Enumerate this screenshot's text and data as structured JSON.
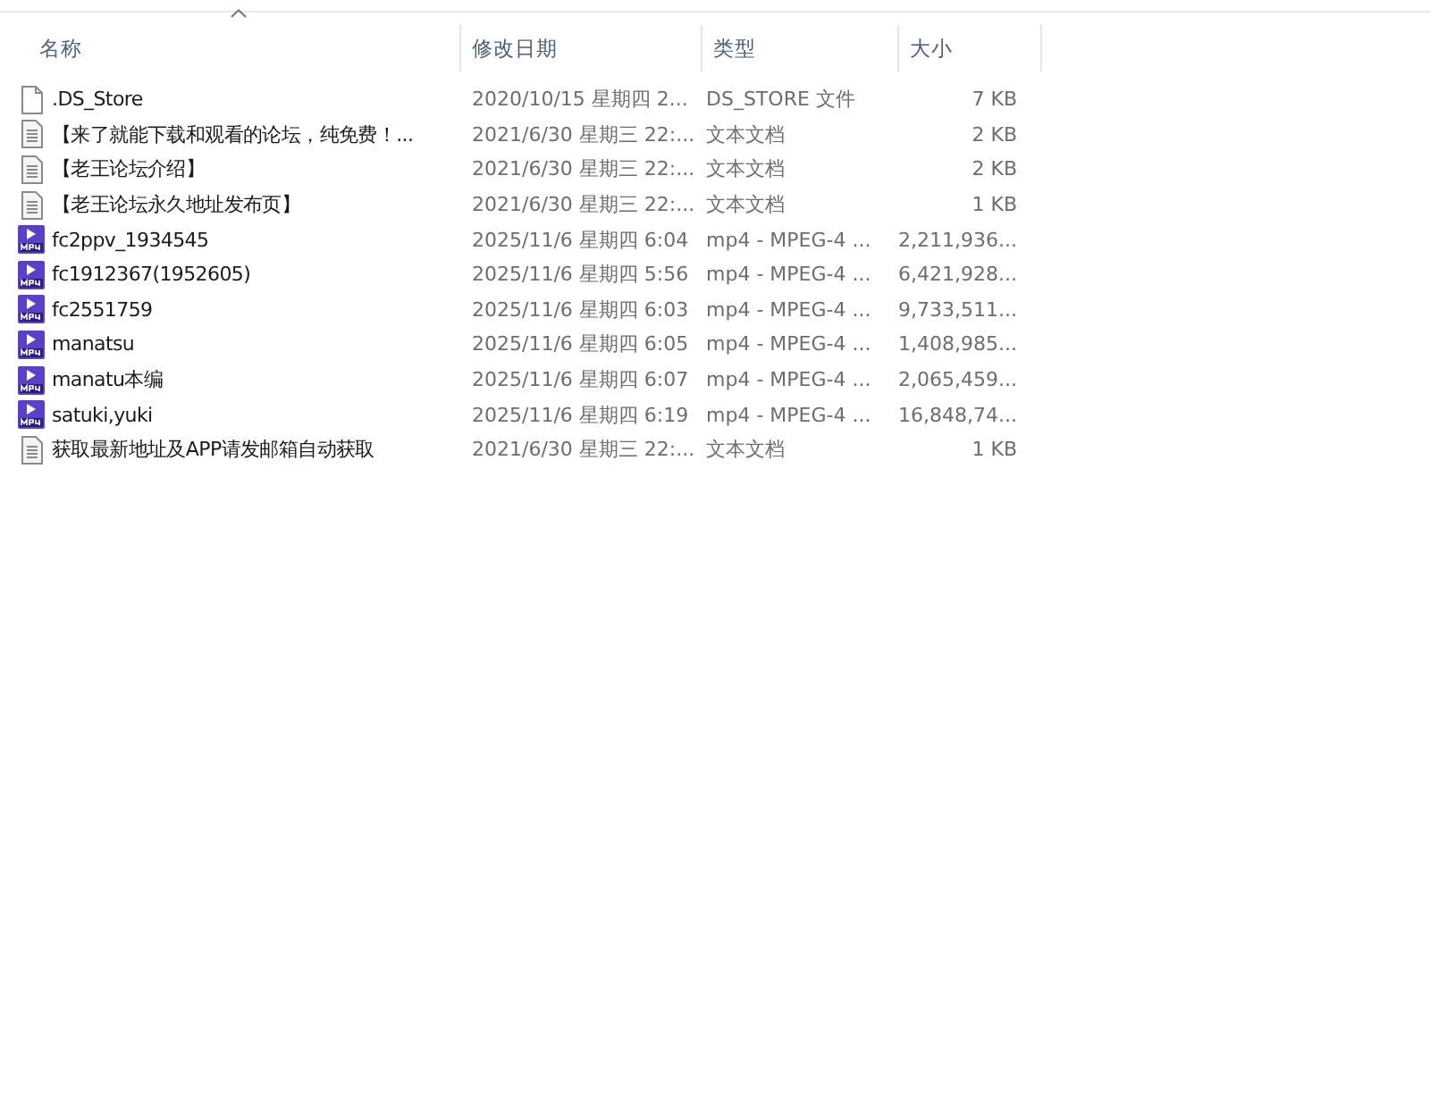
{
  "columns": [
    {
      "label": "名称",
      "sorted": true
    },
    {
      "label": "修改日期",
      "sorted": false
    },
    {
      "label": "类型",
      "sorted": false
    },
    {
      "label": "大小",
      "sorted": false
    }
  ],
  "files": [
    {
      "kind": "blank",
      "name": ".DS_Store",
      "modified": "2020/10/15 星期四 2...",
      "type": "DS_STORE 文件",
      "size": "7 KB"
    },
    {
      "kind": "text",
      "name": "【来了就能下载和观看的论坛，纯免费！...",
      "modified": "2021/6/30 星期三 22:...",
      "type": "文本文档",
      "size": "2 KB"
    },
    {
      "kind": "text",
      "name": "【老王论坛介绍】",
      "modified": "2021/6/30 星期三 22:...",
      "type": "文本文档",
      "size": "2 KB"
    },
    {
      "kind": "text",
      "name": "【老王论坛永久地址发布页】",
      "modified": "2021/6/30 星期三 22:...",
      "type": "文本文档",
      "size": "1 KB"
    },
    {
      "kind": "video",
      "name": "fc2ppv_1934545",
      "modified": "2025/11/6 星期四 6:04",
      "type": "mp4 - MPEG-4 ...",
      "size": "2,211,936..."
    },
    {
      "kind": "video",
      "name": "fc1912367(1952605)",
      "modified": "2025/11/6 星期四 5:56",
      "type": "mp4 - MPEG-4 ...",
      "size": "6,421,928..."
    },
    {
      "kind": "video",
      "name": "fc2551759",
      "modified": "2025/11/6 星期四 6:03",
      "type": "mp4 - MPEG-4 ...",
      "size": "9,733,511..."
    },
    {
      "kind": "video",
      "name": "manatsu",
      "modified": "2025/11/6 星期四 6:05",
      "type": "mp4 - MPEG-4 ...",
      "size": "1,408,985..."
    },
    {
      "kind": "video",
      "name": "manatu本编",
      "modified": "2025/11/6 星期四 6:07",
      "type": "mp4 - MPEG-4 ...",
      "size": "2,065,459..."
    },
    {
      "kind": "video",
      "name": "satuki,yuki",
      "modified": "2025/11/6 星期四 6:19",
      "type": "mp4 - MPEG-4 ...",
      "size": "16,848,74..."
    },
    {
      "kind": "text",
      "name": "获取最新地址及APP请发邮箱自动获取",
      "modified": "2021/6/30 星期三 22:...",
      "type": "文本文档",
      "size": "1 KB"
    }
  ]
}
